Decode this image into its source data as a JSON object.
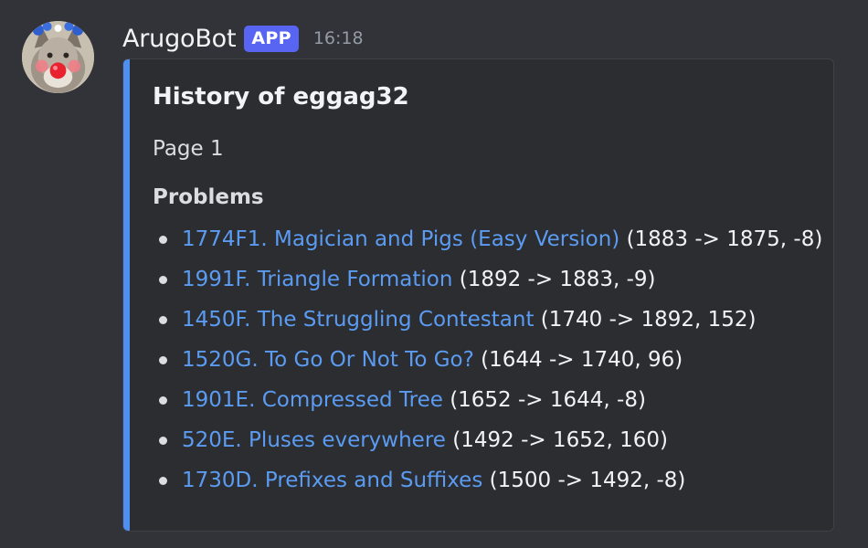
{
  "message": {
    "author": "ArugoBot",
    "badge": "APP",
    "time": "16:18",
    "avatar_icon": "wolf-avatar-icon"
  },
  "embed": {
    "accent_color": "#4f8ff0",
    "title": "History of eggag32",
    "description": "Page 1",
    "field_name": "Problems",
    "problems": [
      {
        "link": "1774F1. Magician and Pigs (Easy Version)",
        "change": "(1883 -> 1875, -8)"
      },
      {
        "link": "1991F. Triangle Formation",
        "change": "(1892 -> 1883, -9)"
      },
      {
        "link": "1450F. The Struggling Contestant",
        "change": "(1740 -> 1892, 152)"
      },
      {
        "link": "1520G. To Go Or Not To Go?",
        "change": "(1644 -> 1740, 96)"
      },
      {
        "link": "1901E. Compressed Tree",
        "change": "(1652 -> 1644, -8)"
      },
      {
        "link": "520E. Pluses everywhere",
        "change": "(1492 -> 1652, 160)"
      },
      {
        "link": "1730D. Prefixes and Suffixes",
        "change": "(1500 -> 1492, -8)"
      }
    ]
  },
  "colors": {
    "background": "#313338",
    "embed_background": "#2b2d31",
    "link": "#5b9cf2",
    "badge": "#5865f2"
  }
}
